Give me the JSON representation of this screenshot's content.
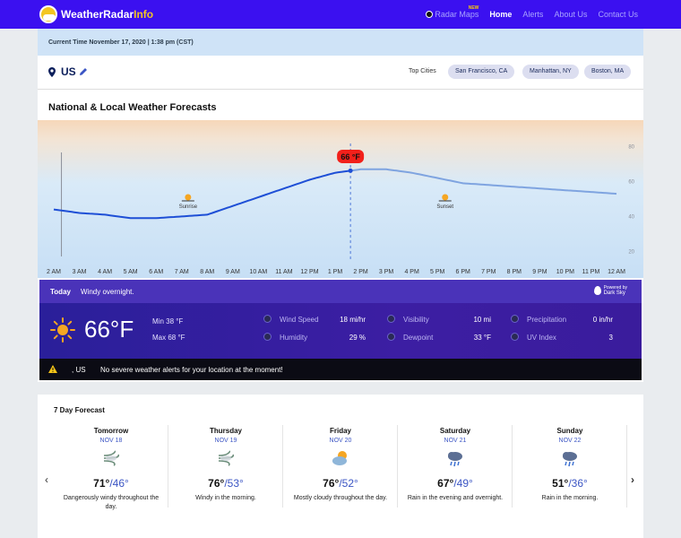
{
  "nav": {
    "logo_main": "WeatherRadar",
    "logo_accent": "Info",
    "links": [
      {
        "label": "Radar Maps",
        "active": false
      },
      {
        "label": "Home",
        "active": true
      },
      {
        "label": "Alerts",
        "active": false
      },
      {
        "label": "About Us",
        "active": false
      },
      {
        "label": "Contact Us",
        "active": false
      }
    ],
    "new_badge": "NEW"
  },
  "time_bar": "Current Time November 17, 2020 | 1:38 pm (CST)",
  "location": {
    "name": "US",
    "top_cities_label": "Top Cities",
    "cities": [
      "San Francisco, CA",
      "Manhattan, NY",
      "Boston, MA"
    ]
  },
  "forecast_title": "National & Local Weather Forecasts",
  "chart_data": {
    "type": "line",
    "x": [
      "2 AM",
      "3 AM",
      "4 AM",
      "5 AM",
      "6 AM",
      "7 AM",
      "8 AM",
      "9 AM",
      "10 AM",
      "11 AM",
      "12 PM",
      "1 PM",
      "2 PM",
      "3 PM",
      "4 PM",
      "5 PM",
      "6 PM",
      "7 PM",
      "8 PM",
      "9 PM",
      "10 PM",
      "11 PM",
      "12 AM"
    ],
    "series": [
      {
        "values": [
          44,
          42,
          41,
          39,
          39,
          40,
          41,
          46,
          51,
          56,
          61,
          65,
          67,
          67,
          65,
          62,
          59,
          58,
          57,
          56,
          55,
          54,
          53
        ]
      }
    ],
    "current_index": 11.6,
    "current_label": "66 °F",
    "yticks": [
      20,
      40,
      60,
      80
    ],
    "ylim": [
      14,
      90
    ],
    "annotations": [
      {
        "x_index": 5.25,
        "label": "Sunrise"
      },
      {
        "x_index": 15.3,
        "label": "Sunset"
      }
    ],
    "grid": false
  },
  "today": {
    "label": "Today",
    "summary": "Windy overnight.",
    "powered_line1": "Powered by",
    "powered_line2": "Dark Sky",
    "temp": "66°F",
    "min": "Min 38 °F",
    "max": "Max 68 °F",
    "metrics": [
      {
        "icon": "wind-icon",
        "label": "Wind Speed",
        "value": "18 mi/hr"
      },
      {
        "icon": "visibility-icon",
        "label": "Visibility",
        "value": "10 mi"
      },
      {
        "icon": "precipitation-icon",
        "label": "Precipitation",
        "value": "0 in/hr"
      },
      {
        "icon": "humidity-icon",
        "label": "Humidity",
        "value": "29 %"
      },
      {
        "icon": "dewpoint-icon",
        "label": "Dewpoint",
        "value": "33 °F"
      },
      {
        "icon": "uv-index-icon",
        "label": "UV Index",
        "value": "3"
      }
    ]
  },
  "alert": {
    "location": ", US",
    "text": "No severe weather alerts for your location at the moment!"
  },
  "seven_day": {
    "title": "7 Day Forecast",
    "days": [
      {
        "name": "Tomorrow",
        "date": "NOV 18",
        "icon": "wind-icon",
        "hi": "71°",
        "lo": "/46°",
        "desc": "Dangerously windy throughout the day."
      },
      {
        "name": "Thursday",
        "date": "NOV 19",
        "icon": "wind-icon",
        "hi": "76°",
        "lo": "/53°",
        "desc": "Windy in the morning."
      },
      {
        "name": "Friday",
        "date": "NOV 20",
        "icon": "partly-cloudy-icon",
        "hi": "76°",
        "lo": "/52°",
        "desc": "Mostly cloudy throughout the day."
      },
      {
        "name": "Saturday",
        "date": "NOV 21",
        "icon": "rain-icon",
        "hi": "67°",
        "lo": "/49°",
        "desc": "Rain in the evening and overnight."
      },
      {
        "name": "Sunday",
        "date": "NOV 22",
        "icon": "rain-icon",
        "hi": "51°",
        "lo": "/36°",
        "desc": "Rain in the morning."
      }
    ]
  }
}
